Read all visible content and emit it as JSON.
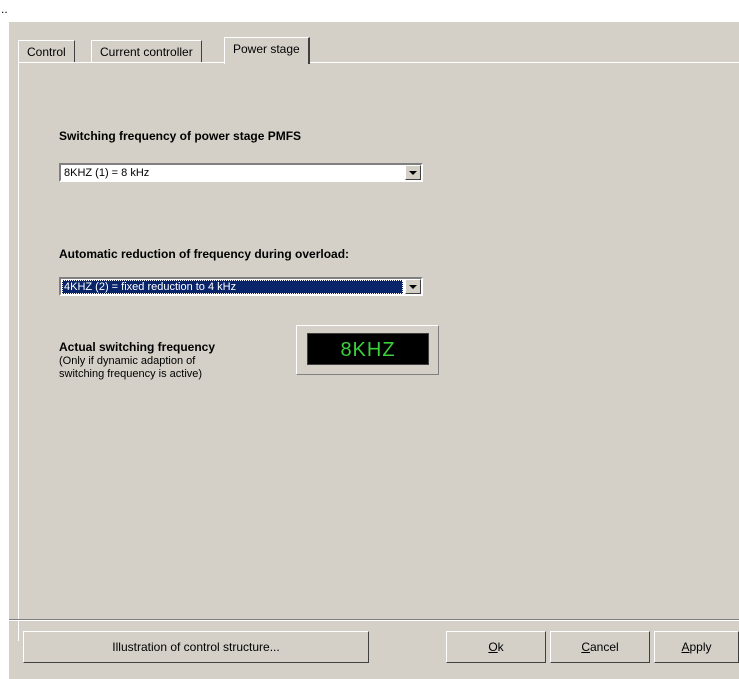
{
  "window": {
    "title_fragment": ".."
  },
  "tabs": [
    {
      "label": "Control"
    },
    {
      "label": "Current controller"
    },
    {
      "label": "Power stage"
    }
  ],
  "switching": {
    "label": "Switching frequency of power stage PMFS",
    "value": "8KHZ (1) = 8 kHz"
  },
  "reduction": {
    "label": "Automatic reduction of frequency during overload:",
    "value": "4KHZ (2) = fixed reduction to 4 kHz"
  },
  "actual": {
    "label": "Actual switching frequency",
    "note_line1": "(Only if dynamic adaption of",
    "note_line2": "switching frequency is active)",
    "display": "8KHZ"
  },
  "buttons": {
    "illustration": "Illustration of control structure...",
    "ok_mnemonic": "O",
    "ok_rest": "k",
    "cancel_mnemonic": "C",
    "cancel_rest": "ancel",
    "apply_mnemonic": "A",
    "apply_rest": "pply"
  },
  "colors": {
    "dialog_bg": "#d4d0c8",
    "selection_bg": "#0a246a",
    "display_fg": "#3ccf3c"
  }
}
